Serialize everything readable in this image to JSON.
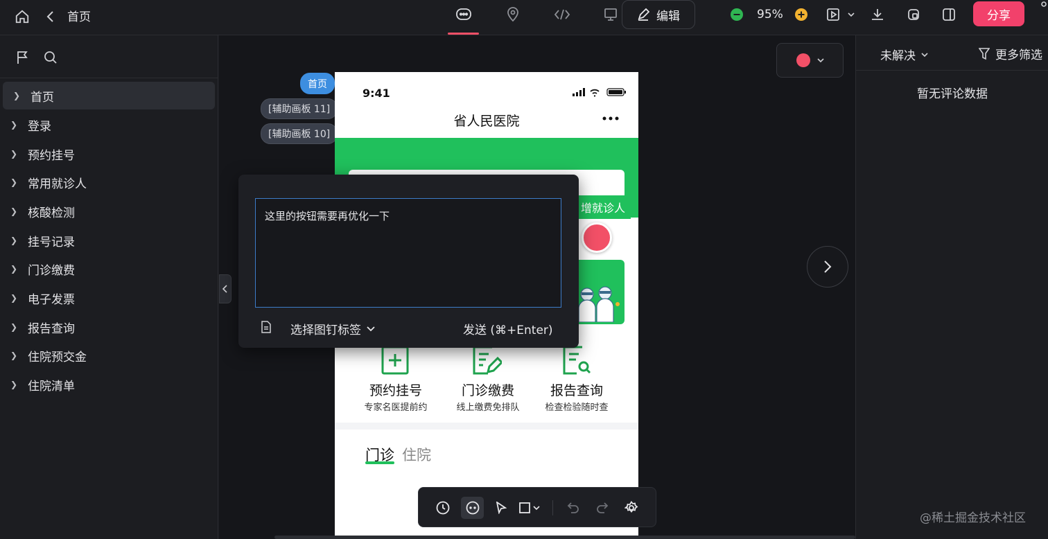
{
  "topbar": {
    "back_title": "首页",
    "zoom": "95%",
    "edit_label": "编辑",
    "share_label": "分享"
  },
  "sidebar": {
    "items": [
      {
        "label": "首页",
        "active": true
      },
      {
        "label": "登录"
      },
      {
        "label": "预约挂号"
      },
      {
        "label": "常用就诊人"
      },
      {
        "label": "核酸检测"
      },
      {
        "label": "挂号记录"
      },
      {
        "label": "门诊缴费"
      },
      {
        "label": "电子发票"
      },
      {
        "label": "报告查询"
      },
      {
        "label": "住院预交金"
      },
      {
        "label": "住院清单"
      }
    ]
  },
  "canvas": {
    "chips": [
      "首页",
      "[辅助画板 11]",
      "[辅助画板 10]"
    ],
    "color_dropdown": {
      "color": "#f25067"
    },
    "phone": {
      "time": "9:41",
      "title": "省人民医院",
      "add_patient": "增就诊人",
      "services": [
        {
          "title": "预约挂号",
          "sub": "专家名医提前约"
        },
        {
          "title": "门诊缴费",
          "sub": "线上缴费免排队"
        },
        {
          "title": "报告查询",
          "sub": "检查检验随时查"
        }
      ],
      "tabs": [
        "门诊",
        "住院"
      ],
      "accent": "#20c05c"
    },
    "comment": {
      "text": "这里的按钮需要再优化一下",
      "pin_tag_label": "选择图钉标签",
      "send_label": "发送 (⌘+Enter)"
    }
  },
  "rightpanel": {
    "filter_status": "未解决",
    "more_filter": "更多筛选",
    "empty_text": "暂无评论数据"
  },
  "watermark": "@稀土掘金技术社区"
}
